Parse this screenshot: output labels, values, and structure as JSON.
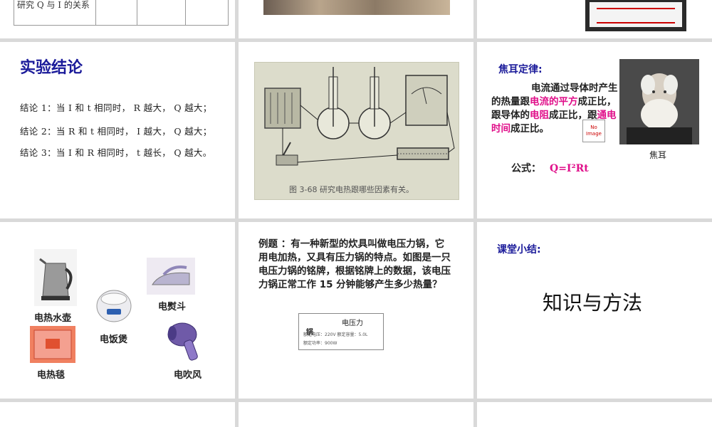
{
  "row0": {
    "table_label": "研究 Q 与 I 的关系"
  },
  "conclusion_slide": {
    "title": "实验结论",
    "lines": [
      "结论 1：当 I 和 t 相同时， R 越大， Q 越大；",
      "结论 2：当 R 和 t 相同时， I 越大， Q 越大；",
      "结论 3：当 I 和 R 相同时， t 越长， Q 越大。"
    ]
  },
  "lab_slide": {
    "caption": "图 3-68  研究电热跟哪些因素有关。"
  },
  "joule_slide": {
    "title": "焦耳定律:",
    "text_1": "电流通过导体时产生的热量跟",
    "hl_1": "电流的平方",
    "text_2": "成正比，跟导体的",
    "hl_2": "电阻",
    "text_3": "成正比，跟",
    "hl_3": "通电时间",
    "text_4": "成正比。",
    "no_image": "No Image",
    "portrait_caption": "焦耳",
    "formula_label": "公式：",
    "formula": "Q=I²Rt"
  },
  "appliances_slide": {
    "kettle": "电热水壶",
    "iron": "电熨斗",
    "rice_cooker": "电饭煲",
    "blanket": "电热毯",
    "hair_dryer": "电吹风"
  },
  "example_slide": {
    "text": "例题 ：有一种新型的炊具叫做电压力锅，它用电加热，又具有压力锅的特点。如图是一只电压力锅的铭牌，根据铭牌上的数据，该电压力锅正常工作 15 分钟能够产生多少热量？",
    "nameplate_title": "电压力",
    "nameplate_sub": "锅",
    "nameplate_line1": "额定电压：220V      额定容量：5.0L",
    "nameplate_line2": "额定功率：900W"
  },
  "summary_slide": {
    "title": "课堂小结:",
    "big": "知识与方法"
  }
}
